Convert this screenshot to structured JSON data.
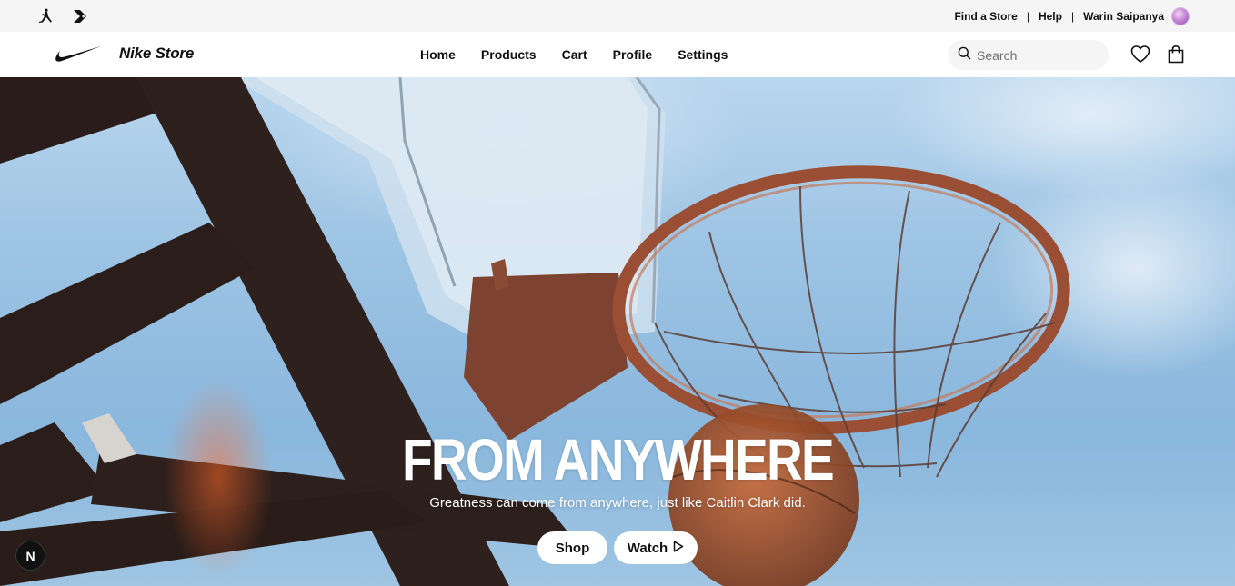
{
  "utility_bar": {
    "links": [
      "Find a Store",
      "Help"
    ],
    "user_name": "Warin Saipanya"
  },
  "header": {
    "store_name": "Nike Store",
    "nav": [
      "Home",
      "Products",
      "Cart",
      "Profile",
      "Settings"
    ],
    "search_placeholder": "Search"
  },
  "hero": {
    "title": "FROM ANYWHERE",
    "subtitle": "Greatness can come from anywhere, just like Caitlin Clark did.",
    "shop_label": "Shop",
    "watch_label": "Watch"
  },
  "badge": {
    "letter": "N"
  },
  "colors": {
    "text": "#111111",
    "utility_bg": "#f5f5f5",
    "search_bg": "#f5f5f5",
    "hero_sky": "#9cc3e3"
  }
}
